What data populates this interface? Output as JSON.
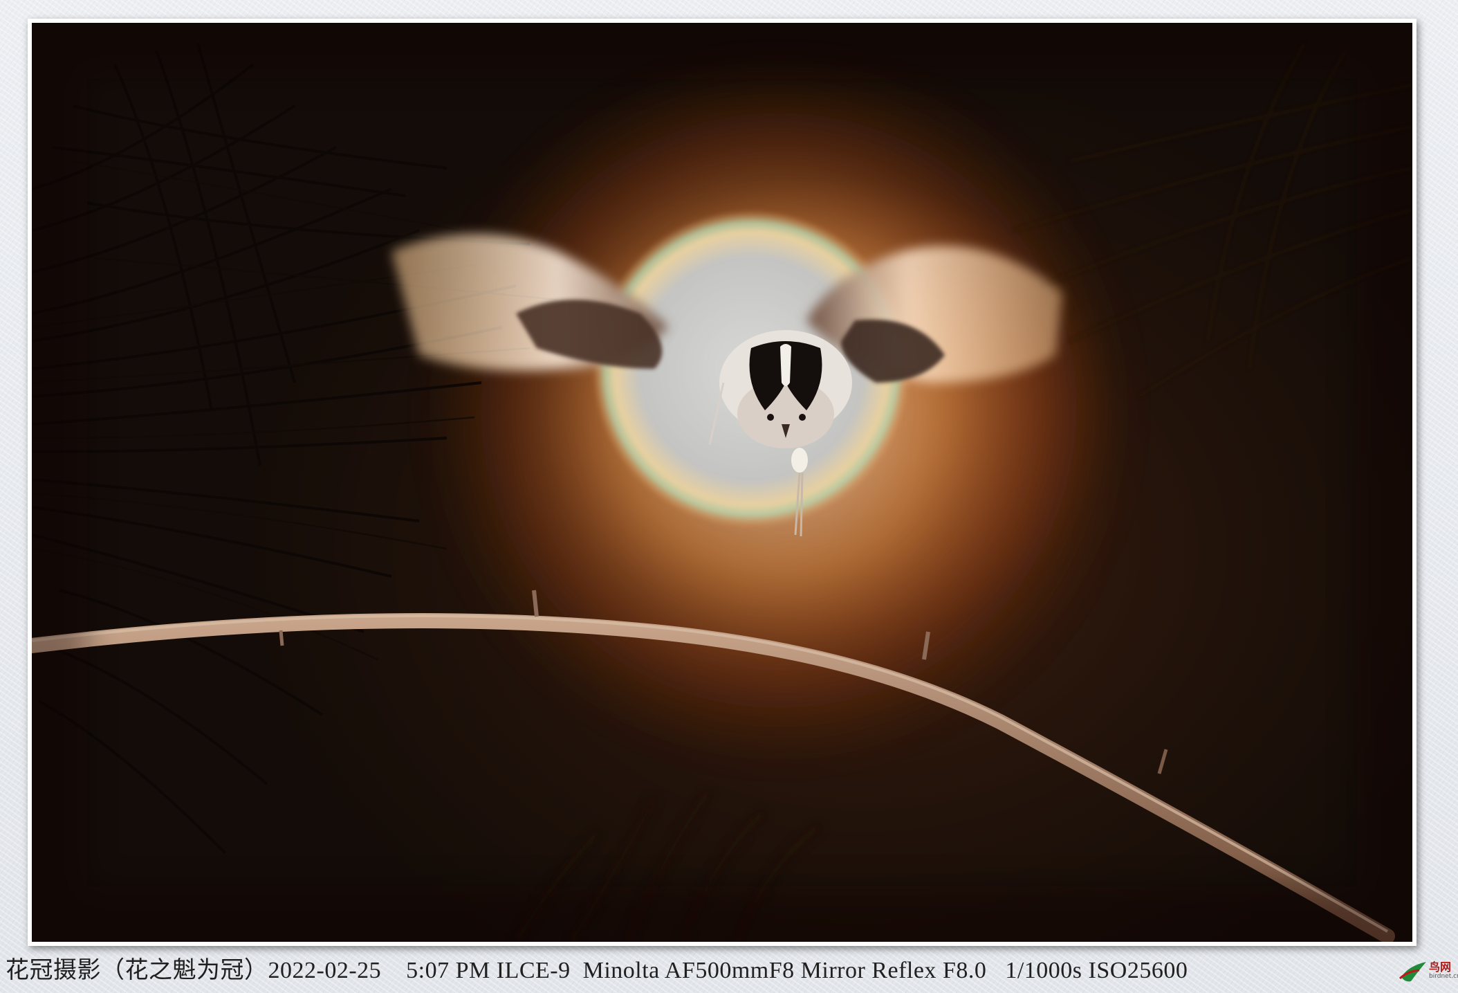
{
  "caption": {
    "author": "花冠摄影（花之魁为冠）",
    "date": "2022-02-25",
    "time": "5:07 PM",
    "camera": "ILCE-9",
    "lens": "Minolta AF500mmF8 Mirror Reflex",
    "aperture": "F8.0",
    "shutter": "1/1000s",
    "iso": "ISO25600"
  },
  "watermark": {
    "name": "鸟网",
    "site": "birdnet.cn",
    "icon": "birdnet-logo-icon"
  },
  "photo": {
    "subject": "bird-in-flight",
    "colors": {
      "background": "#1a0f08",
      "glow": "#e07a2a",
      "halo": "#c9c8c6",
      "branch": "#a07b62"
    }
  }
}
